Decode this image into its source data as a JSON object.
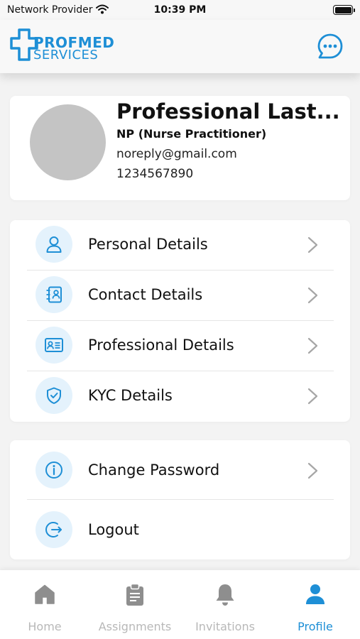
{
  "status_bar": {
    "carrier": "Network Provider",
    "time": "10:39 PM",
    "icons": [
      "wifi-icon",
      "battery-icon"
    ]
  },
  "header": {
    "logo_top": "PROFMED",
    "logo_bottom": "SERVICES",
    "chat_icon": "chat-bubble-icon"
  },
  "profile": {
    "name": "Professional  Last...",
    "role": "NP (Nurse Practitioner)",
    "email": "noreply@gmail.com",
    "phone": "1234567890"
  },
  "menu_primary": [
    {
      "label": "Personal Details",
      "icon": "user-icon"
    },
    {
      "label": "Contact Details",
      "icon": "contact-card-icon"
    },
    {
      "label": "Professional Details",
      "icon": "id-card-icon"
    },
    {
      "label": "KYC Details",
      "icon": "shield-check-icon"
    }
  ],
  "menu_secondary": [
    {
      "label": "Change Password",
      "icon": "info-icon"
    },
    {
      "label": "Logout",
      "icon": "logout-icon"
    }
  ],
  "tabs": [
    {
      "label": "Home",
      "icon": "home-icon",
      "active": false
    },
    {
      "label": "Assignments",
      "icon": "clipboard-icon",
      "active": false
    },
    {
      "label": "Invitations",
      "icon": "bell-icon",
      "active": false
    },
    {
      "label": "Profile",
      "icon": "person-icon",
      "active": true
    }
  ],
  "colors": {
    "accent": "#1e8fd6",
    "icon_bg": "#e4f2fc",
    "inactive_tab": "#b8b8b8",
    "background": "#f3f3f3"
  }
}
